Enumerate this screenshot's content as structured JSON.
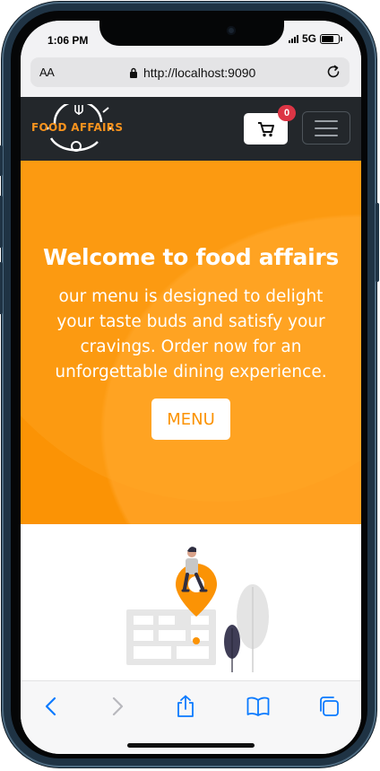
{
  "status": {
    "time": "1:06 PM",
    "network": "5G",
    "battery_level": 0.85
  },
  "browser": {
    "aa_label": "AA",
    "url": "http://localhost:9090"
  },
  "navbar": {
    "brand": "FOOD AFFAIRS",
    "cart_count": "0"
  },
  "hero": {
    "title": "Welcome to food affairs",
    "subtitle": "our menu is designed to delight your taste buds and satisfy your cravings. Order now for an unforgettable dining experience.",
    "button_label": "MENU"
  },
  "colors": {
    "accent": "#fb9305",
    "navbar": "#23272b",
    "badge": "#dc3545",
    "ios_blue": "#0a7aff"
  },
  "toolbar": {
    "icons": [
      "back-icon",
      "forward-icon",
      "share-icon",
      "bookmarks-icon",
      "tabs-icon"
    ]
  }
}
